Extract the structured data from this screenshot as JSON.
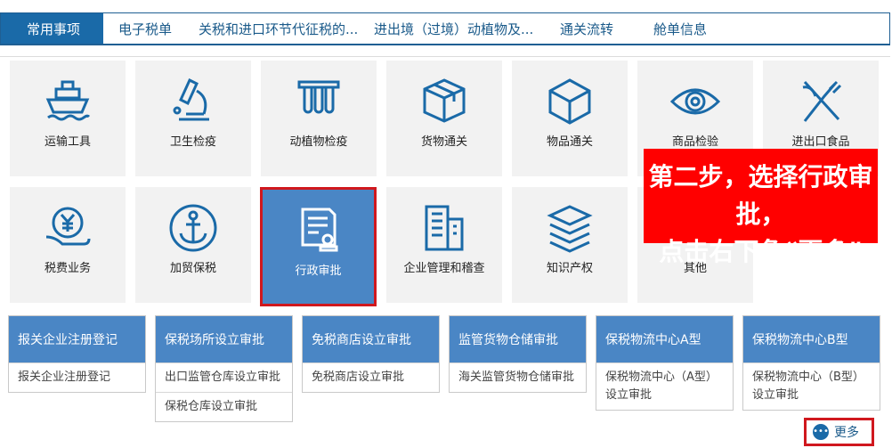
{
  "tabs": [
    {
      "label": "常用事项"
    },
    {
      "label": "电子税单"
    },
    {
      "label": "关税和进口环节代征税的..."
    },
    {
      "label": "进出境（过境）动植物及..."
    },
    {
      "label": "通关流转"
    },
    {
      "label": "舱单信息"
    }
  ],
  "tiles": [
    {
      "label": "运输工具",
      "icon": "ship-icon"
    },
    {
      "label": "卫生检疫",
      "icon": "microscope-icon"
    },
    {
      "label": "动植物检疫",
      "icon": "test-tubes-icon"
    },
    {
      "label": "货物通关",
      "icon": "box-icon"
    },
    {
      "label": "物品通关",
      "icon": "cube-icon"
    },
    {
      "label": "商品检验",
      "icon": "eye-icon"
    },
    {
      "label": "进出口食品",
      "icon": "fork-knife-icon"
    },
    {
      "label": "税费业务",
      "icon": "yuan-hand-icon"
    },
    {
      "label": "加贸保税",
      "icon": "anchor-icon"
    },
    {
      "label": "行政审批",
      "icon": "document-stamp-icon"
    },
    {
      "label": "企业管理和稽查",
      "icon": "building-icon"
    },
    {
      "label": "知识产权",
      "icon": "books-icon"
    },
    {
      "label": "其他",
      "icon": "other-icon"
    }
  ],
  "annotation": {
    "line1": "第二步，选择行政审批，",
    "line2": "点击右下角“更多”"
  },
  "cards": [
    {
      "title": "报关企业注册登记",
      "items": [
        "报关企业注册登记"
      ]
    },
    {
      "title": "保税场所设立审批",
      "items": [
        "出口监管仓库设立审批",
        "保税仓库设立审批"
      ]
    },
    {
      "title": "免税商店设立审批",
      "items": [
        "免税商店设立审批"
      ]
    },
    {
      "title": "监管货物仓储审批",
      "items": [
        "海关监管货物仓储审批"
      ]
    },
    {
      "title": "保税物流中心A型",
      "items": [
        "保税物流中心（A型）设立审批"
      ]
    },
    {
      "title": "保税物流中心B型",
      "items": [
        "保税物流中心（B型）设立审批"
      ]
    }
  ],
  "more": {
    "label": "更多",
    "dot": "•••"
  },
  "colors": {
    "accent": "#1a6aa8",
    "tile_bg": "#f2f2f2",
    "highlight": "#4a86c5",
    "annotation_red": "#ff0000"
  }
}
